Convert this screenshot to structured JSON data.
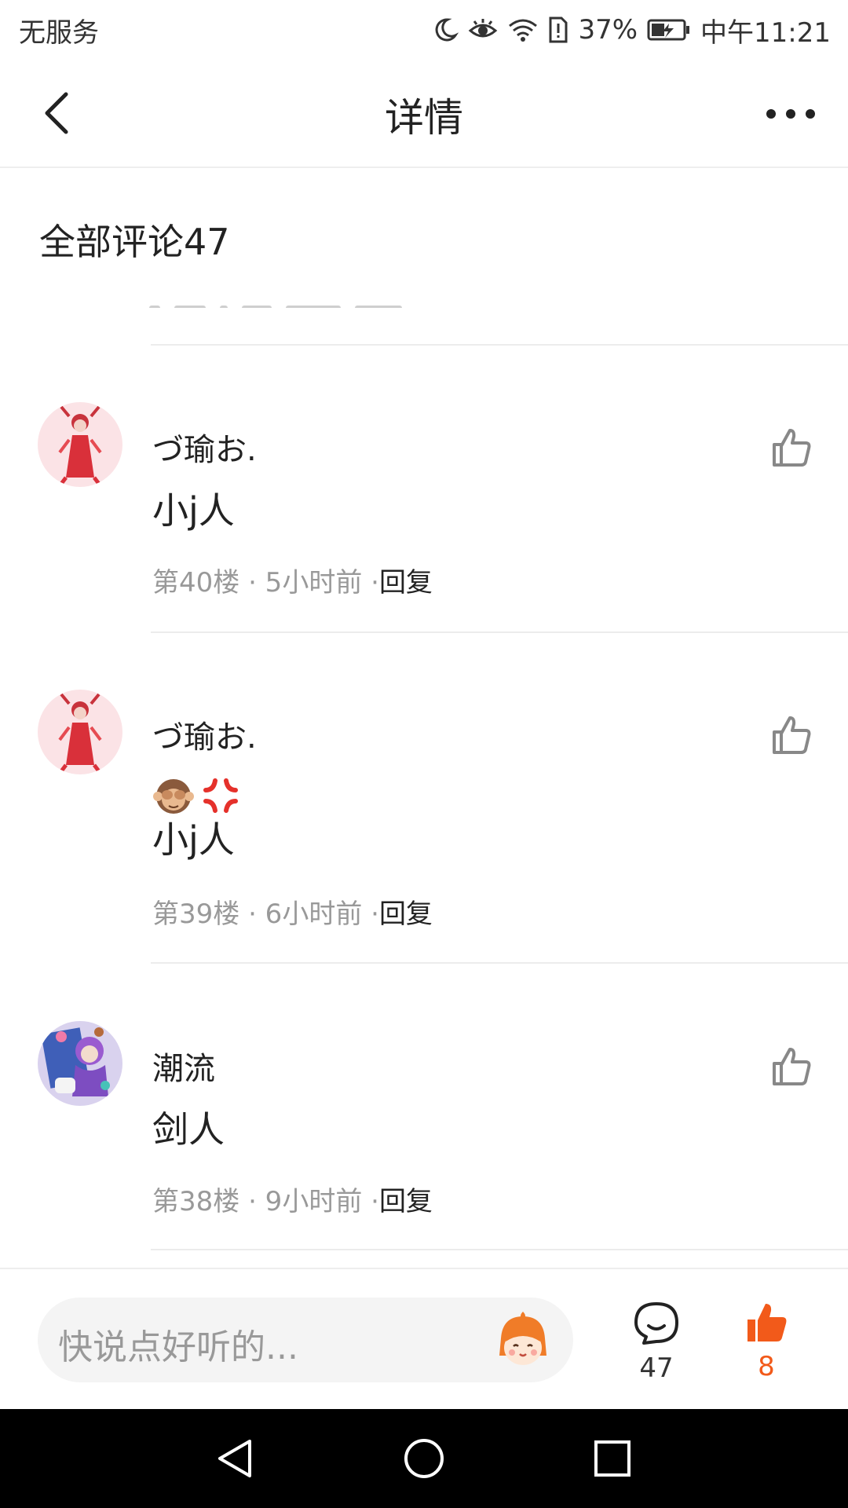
{
  "status_bar": {
    "carrier": "无服务",
    "battery_percent": "37%",
    "time": "中午11:21"
  },
  "header": {
    "title": "详情"
  },
  "comments_header": "全部评论47",
  "comments": [
    {
      "username": "づ瑜お.",
      "emojis": [],
      "text": "小j人",
      "floor_time": "第40楼 · 5小时前 ·",
      "reply_label": "回复"
    },
    {
      "username": "づ瑜お.",
      "emojis": [
        "🙊",
        "💢"
      ],
      "text": "小j人",
      "floor_time": "第39楼 · 6小时前 ·",
      "reply_label": "回复"
    },
    {
      "username": "潮流",
      "emojis": [],
      "text": "剑人",
      "floor_time": "第38楼 · 9小时前 ·",
      "reply_label": "回复"
    }
  ],
  "bottom_bar": {
    "placeholder": "快说点好听的...",
    "comment_count": "47",
    "like_count": "8"
  },
  "colors": {
    "accent": "#f25a1a",
    "text_primary": "#222222",
    "text_secondary": "#999999",
    "divider": "#ececec"
  },
  "icons": [
    "back-arrow-icon",
    "more-dots-icon",
    "thumbs-up-icon",
    "comment-bubble-icon",
    "mascot-icon",
    "nav-back-icon",
    "nav-home-icon",
    "nav-recents-icon"
  ]
}
